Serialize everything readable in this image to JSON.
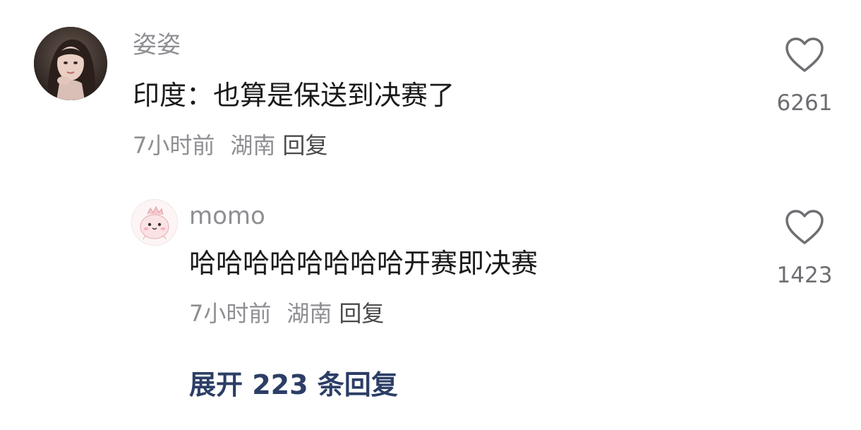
{
  "comment": {
    "username": "姿姿",
    "text": "印度：也算是保送到决赛了",
    "time": "7小时前",
    "location": "湖南",
    "reply_label": "回复",
    "like_count": "6261",
    "avatar_icon": "avatar-photo-icon",
    "like_icon": "heart-outline-icon"
  },
  "reply": {
    "username": "momo",
    "text": "哈哈哈哈哈哈哈哈开赛即决赛",
    "time": "7小时前",
    "location": "湖南",
    "reply_label": "回复",
    "like_count": "1423",
    "avatar_icon": "cartoon-avatar-icon",
    "like_icon": "heart-outline-icon"
  },
  "expand_label": "展开 223 条回复",
  "colors": {
    "username": "#8e8e93",
    "text": "#1a1a1a",
    "meta": "#8e8e93",
    "expand": "#2c3e66"
  }
}
